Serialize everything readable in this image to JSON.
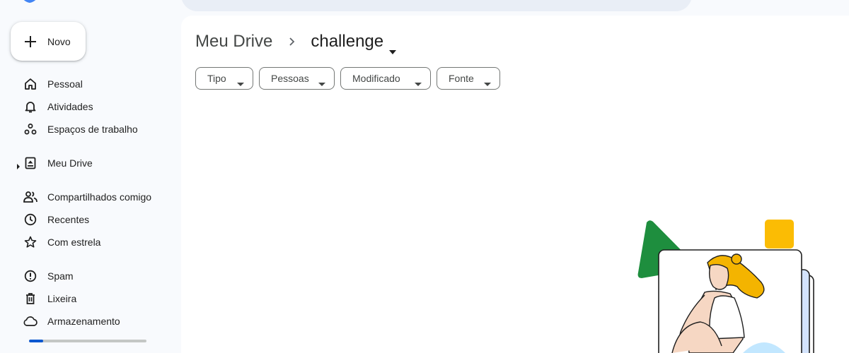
{
  "header": {
    "logo_icon": "google-drive-logo-icon"
  },
  "sidebar": {
    "new_button": {
      "label": "Novo",
      "icon": "plus-icon"
    },
    "items": [
      {
        "label": "Pessoal",
        "icon": "home-icon"
      },
      {
        "label": "Atividades",
        "icon": "bell-icon"
      },
      {
        "label": "Espaços de trabalho",
        "icon": "workspaces-icon"
      },
      {
        "label": "Meu Drive",
        "icon": "drive-icon"
      },
      {
        "label": "Compartilhados comigo",
        "icon": "people-icon"
      },
      {
        "label": "Recentes",
        "icon": "clock-icon"
      },
      {
        "label": "Com estrela",
        "icon": "star-icon"
      },
      {
        "label": "Spam",
        "icon": "spam-icon"
      },
      {
        "label": "Lixeira",
        "icon": "trash-icon"
      },
      {
        "label": "Armazenamento",
        "icon": "cloud-icon"
      }
    ],
    "storage_fraction": 0.12,
    "accent_color": "#0b57d0"
  },
  "breadcrumb": {
    "root": "Meu Drive",
    "current": "challenge"
  },
  "filters": [
    {
      "label": "Tipo"
    },
    {
      "label": "Pessoas"
    },
    {
      "label": "Modificado"
    },
    {
      "label": "Fonte"
    }
  ],
  "colors": {
    "background": "#f8fafd",
    "surface": "#ffffff",
    "search_bar": "#e9eef6",
    "illustration_green": "#1e8e3e",
    "illustration_yellow": "#fbbc04"
  }
}
